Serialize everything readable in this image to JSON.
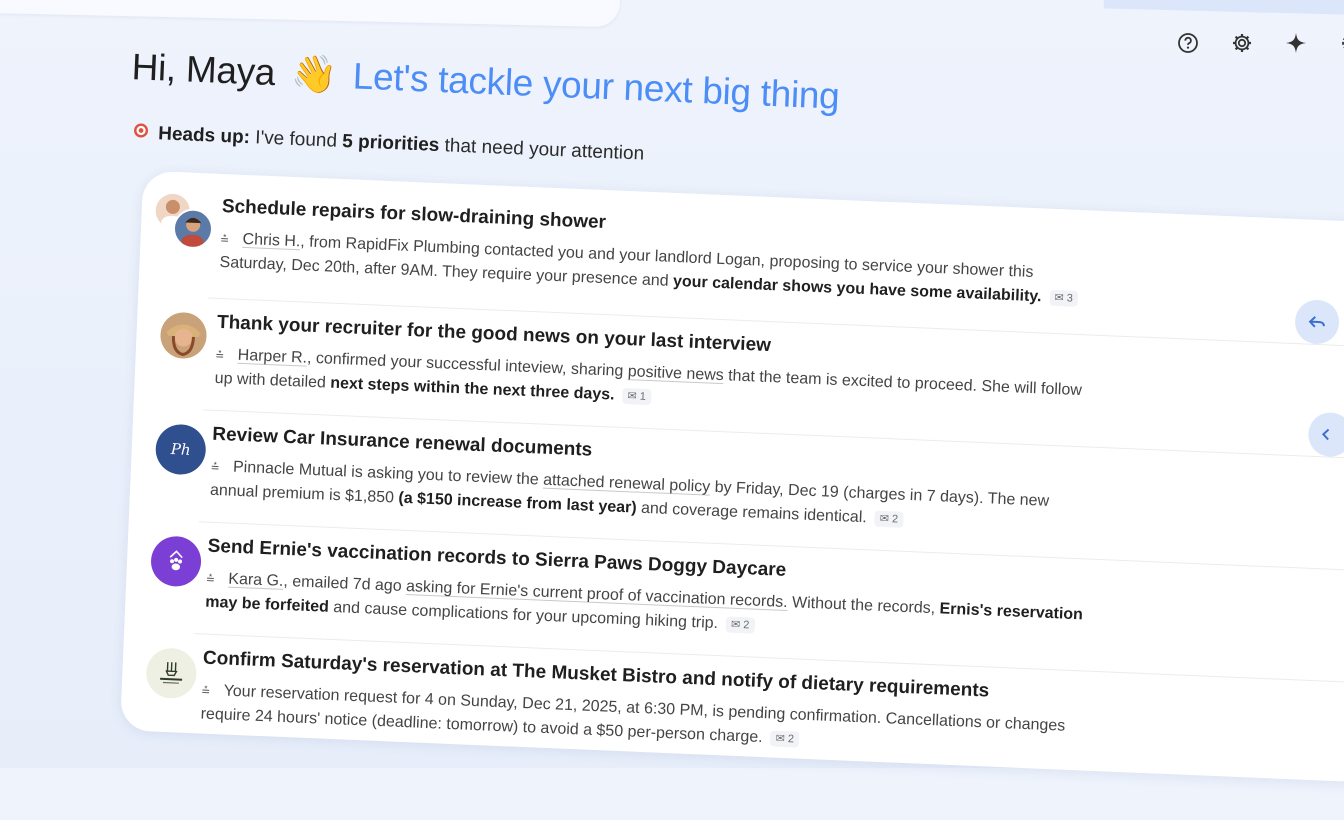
{
  "header": {
    "greeting": "Hi, Maya",
    "wave": "👋",
    "tagline": "Let's tackle your next big thing"
  },
  "alert": {
    "icon": "target-icon",
    "label": "Heads up:",
    "text_before": "I've found",
    "count_text": "5 priorities",
    "text_after": "that need your attention"
  },
  "toolbar": {
    "icons": [
      "help-icon",
      "settings-icon",
      "sparkle-icon",
      "apps-icon"
    ]
  },
  "items": [
    {
      "title": "Schedule repairs for slow-draining shower",
      "sender": "Chris H.",
      "pre": ", from RapidFix Plumbing contacted you and your landlord Logan, proposing to service your shower this Saturday, Dec 20th, after 9AM. They require your presence and ",
      "bold": "your calendar shows you have some availability.",
      "post": "",
      "count": "3"
    },
    {
      "title": "Thank your recruiter for the good news on your last interview",
      "sender": "Harper R.",
      "pre": ", confirmed your successful inteview, sharing ",
      "link": "positive news",
      "mid": " that the team is excited to proceed. She will follow up with detailed ",
      "bold": "next steps within the next three days.",
      "count": "1"
    },
    {
      "title": "Review Car Insurance renewal documents",
      "pre": "Pinnacle Mutual is asking you to review the ",
      "link": "attached renewal policy",
      "mid": " by Friday, Dec 19 (charges in 7 days). The new annual premium is $1,850 ",
      "bold": "(a $150 increase from last year)",
      "post": " and coverage remains identical.",
      "count": "2",
      "logo_text": "Ph"
    },
    {
      "title": "Send Ernie's vaccination records to Sierra Paws Doggy Daycare",
      "sender": "Kara G.",
      "pre": ", emailed 7d ago ",
      "link": "asking for Ernie's current proof of vaccination records.",
      "mid": " Without the records, ",
      "bold": "Ernis's reservation may be forfeited",
      "post": " and cause complications for your upcoming hiking trip.",
      "count": "2"
    },
    {
      "title": "Confirm Saturday's reservation at The Musket Bistro and notify of dietary requirements",
      "pre": "Your reservation request for 4 on Sunday, Dec 21, 2025, at 6:30 PM, is pending confirmation. Cancellations or changes require 24 hours' notice (deadline: tomorrow) to avoid a $50 per-person charge.",
      "count": "2"
    }
  ],
  "colors": {
    "accent": "#4c8df6",
    "insurance_logo": "#2f4f8f",
    "paws_logo": "#7b3fd6"
  }
}
